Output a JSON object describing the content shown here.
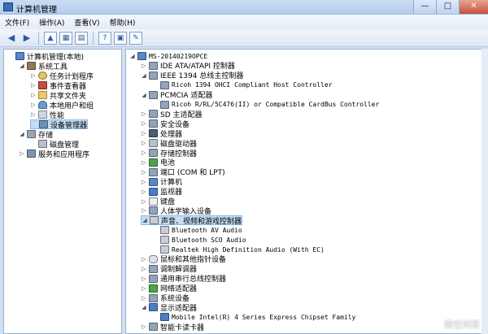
{
  "window": {
    "title": "计算机管理",
    "min": "—",
    "max": "□",
    "close": "✕"
  },
  "menu": [
    "文件(F)",
    "操作(A)",
    "查看(V)",
    "帮助(H)"
  ],
  "toolbar": [
    {
      "name": "back-icon",
      "glyph": "◀"
    },
    {
      "name": "forward-icon",
      "glyph": "▶"
    },
    {
      "name": "up-folder-icon",
      "glyph": "▲"
    },
    {
      "name": "show-hide-tree-icon",
      "glyph": "▦"
    },
    {
      "name": "properties-icon",
      "glyph": "▤"
    },
    {
      "name": "help-icon",
      "glyph": "?"
    },
    {
      "name": "view-icon",
      "glyph": "▣"
    },
    {
      "name": "scan-hardware-icon",
      "glyph": "✎"
    }
  ],
  "left_tree": [
    {
      "label": "计算机管理(本地)",
      "level": 0,
      "exp": "",
      "icon": "ic-computer",
      "icon_name": "computer-management-icon"
    },
    {
      "label": "系统工具",
      "level": 1,
      "exp": "◢",
      "icon": "ic-tool",
      "icon_name": "system-tools-icon"
    },
    {
      "label": "任务计划程序",
      "level": 2,
      "exp": "▷",
      "icon": "ic-clock",
      "icon_name": "task-scheduler-icon"
    },
    {
      "label": "事件查看器",
      "level": 2,
      "exp": "▷",
      "icon": "ic-event",
      "icon_name": "event-viewer-icon"
    },
    {
      "label": "共享文件夹",
      "level": 2,
      "exp": "▷",
      "icon": "ic-folder",
      "icon_name": "shared-folders-icon"
    },
    {
      "label": "本地用户和组",
      "level": 2,
      "exp": "▷",
      "icon": "ic-users",
      "icon_name": "local-users-icon"
    },
    {
      "label": "性能",
      "level": 2,
      "exp": "▷",
      "icon": "ic-perf",
      "icon_name": "performance-icon"
    },
    {
      "label": "设备管理器",
      "level": 2,
      "exp": "",
      "icon": "ic-devmgr",
      "icon_name": "device-manager-icon",
      "selected": true
    },
    {
      "label": "存储",
      "level": 1,
      "exp": "◢",
      "icon": "ic-storage",
      "icon_name": "storage-icon"
    },
    {
      "label": "磁盘管理",
      "level": 2,
      "exp": "",
      "icon": "ic-disk",
      "icon_name": "disk-management-icon"
    },
    {
      "label": "服务和应用程序",
      "level": 1,
      "exp": "▷",
      "icon": "ic-services",
      "icon_name": "services-applications-icon"
    }
  ],
  "device_tree": [
    {
      "label": "MS-20140219OPCE",
      "level": 0,
      "exp": "◢",
      "icon": "ic-computer",
      "mono": true
    },
    {
      "label": "IDE ATA/ATAPI 控制器",
      "level": 1,
      "exp": "▷",
      "icon": "ic-dev"
    },
    {
      "label": "IEEE 1394 总线主控制器",
      "level": 1,
      "exp": "◢",
      "icon": "ic-dev"
    },
    {
      "label": "Ricoh 1394 OHCI Compliant Host Controller",
      "level": 2,
      "exp": "",
      "icon": "ic-dev",
      "mono": true
    },
    {
      "label": "PCMCIA 适配器",
      "level": 1,
      "exp": "◢",
      "icon": "ic-dev"
    },
    {
      "label": "Ricoh R/RL/5C476(II) or Compatible CardBus Controller",
      "level": 2,
      "exp": "",
      "icon": "ic-dev",
      "mono": true
    },
    {
      "label": "SD 主适配器",
      "level": 1,
      "exp": "▷",
      "icon": "ic-dev"
    },
    {
      "label": "安全设备",
      "level": 1,
      "exp": "▷",
      "icon": "ic-dev"
    },
    {
      "label": "处理器",
      "level": 1,
      "exp": "▷",
      "icon": "ic-chip"
    },
    {
      "label": "磁盘驱动器",
      "level": 1,
      "exp": "▷",
      "icon": "ic-disk"
    },
    {
      "label": "存储控制器",
      "level": 1,
      "exp": "▷",
      "icon": "ic-dev"
    },
    {
      "label": "电池",
      "level": 1,
      "exp": "▷",
      "icon": "ic-green"
    },
    {
      "label": "端口 (COM 和 LPT)",
      "level": 1,
      "exp": "▷",
      "icon": "ic-dev"
    },
    {
      "label": "计算机",
      "level": 1,
      "exp": "▷",
      "icon": "ic-computer"
    },
    {
      "label": "监视器",
      "level": 1,
      "exp": "▷",
      "icon": "ic-blue"
    },
    {
      "label": "键盘",
      "level": 1,
      "exp": "▷",
      "icon": "ic-key"
    },
    {
      "label": "人体学输入设备",
      "level": 1,
      "exp": "▷",
      "icon": "ic-dev"
    },
    {
      "label": "声音、视频和游戏控制器",
      "level": 1,
      "exp": "◢",
      "icon": "ic-speaker",
      "selected": true
    },
    {
      "label": "Bluetooth AV Audio",
      "level": 2,
      "exp": "",
      "icon": "ic-speaker",
      "mono": true
    },
    {
      "label": "Bluetooth SCO Audio",
      "level": 2,
      "exp": "",
      "icon": "ic-speaker",
      "mono": true
    },
    {
      "label": "Realtek High Definition Audio (With EC)",
      "level": 2,
      "exp": "",
      "icon": "ic-speaker",
      "mono": true
    },
    {
      "label": "鼠标和其他指针设备",
      "level": 1,
      "exp": "▷",
      "icon": "ic-mouse"
    },
    {
      "label": "调制解调器",
      "level": 1,
      "exp": "▷",
      "icon": "ic-dev"
    },
    {
      "label": "通用串行总线控制器",
      "level": 1,
      "exp": "▷",
      "icon": "ic-dev"
    },
    {
      "label": "网络适配器",
      "level": 1,
      "exp": "▷",
      "icon": "ic-green"
    },
    {
      "label": "系统设备",
      "level": 1,
      "exp": "▷",
      "icon": "ic-dev"
    },
    {
      "label": "显示适配器",
      "level": 1,
      "exp": "◢",
      "icon": "ic-blue"
    },
    {
      "label": "Mobile Intel(R) 4 Series Express Chipset Family",
      "level": 2,
      "exp": "",
      "icon": "ic-blue",
      "mono": true
    },
    {
      "label": "智能卡读卡器",
      "level": 1,
      "exp": "▷",
      "icon": "ic-dev"
    }
  ],
  "watermark": "悟空问答"
}
